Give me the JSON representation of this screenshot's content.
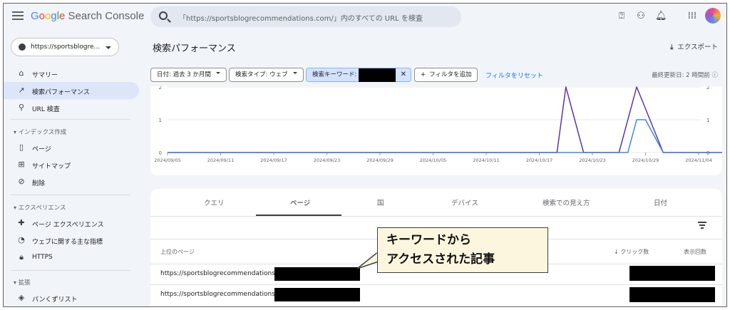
{
  "app": {
    "title_google": "Google",
    "title_rest": " Search Console"
  },
  "search": {
    "placeholder": "「https://sportsblogrecommendations.com/」内のすべての URL を検査"
  },
  "property": {
    "label": "https://sportsblogre..."
  },
  "sidebar": {
    "items": [
      {
        "label": "サマリー",
        "icon": "home-icon"
      },
      {
        "label": "検索パフォーマンス",
        "icon": "trending-icon"
      },
      {
        "label": "URL 検査",
        "icon": "search-icon"
      }
    ],
    "sections": [
      {
        "title": "インデックス作成",
        "items": [
          {
            "label": "ページ",
            "icon": "page-icon"
          },
          {
            "label": "サイトマップ",
            "icon": "sitemap-icon"
          },
          {
            "label": "削除",
            "icon": "remove-icon"
          }
        ]
      },
      {
        "title": "エクスペリエンス",
        "items": [
          {
            "label": "ページ エクスペリエンス",
            "icon": "experience-icon"
          },
          {
            "label": "ウェブに関する主な指標",
            "icon": "speed-icon"
          },
          {
            "label": "HTTPS",
            "icon": "lock-icon"
          }
        ]
      },
      {
        "title": "拡張",
        "items": [
          {
            "label": "パンくずリスト",
            "icon": "breadcrumb-icon"
          }
        ]
      }
    ]
  },
  "header": {
    "title": "検索パフォーマンス",
    "export": "エクスポート"
  },
  "filters": {
    "date": "日付: 過去 3 か月間",
    "type": "検索タイプ: ウェブ",
    "keyword": "検索キーワード:",
    "add": "フィルタを追加",
    "reset": "フィルタをリセット",
    "updated": "最終更新日: 2 時間前"
  },
  "chart_data": {
    "type": "line",
    "x": [
      "2024/09/05",
      "2024/09/11",
      "2024/09/17",
      "2024/09/23",
      "2024/09/29",
      "2024/10/05",
      "2024/10/11",
      "2024/10/17",
      "2024/10/23",
      "2024/10/29",
      "2024/11/04"
    ],
    "left_ticks": [
      "2",
      "1",
      "0"
    ],
    "right_ticks": [
      "2",
      "1",
      "0"
    ],
    "series": [
      {
        "color": "#5e35b1",
        "points": [
          [
            "2024/09/05",
            0
          ],
          [
            "2024/10/19",
            0
          ],
          [
            "2024/10/20",
            2
          ],
          [
            "2024/10/22",
            0
          ],
          [
            "2024/10/26",
            0
          ],
          [
            "2024/10/28",
            2
          ],
          [
            "2024/10/31",
            0
          ],
          [
            "2024/11/08",
            0
          ]
        ]
      },
      {
        "color": "#4285f4",
        "points": [
          [
            "2024/09/05",
            0
          ],
          [
            "2024/10/27",
            0
          ],
          [
            "2024/10/28",
            1
          ],
          [
            "2024/10/29",
            1
          ],
          [
            "2024/10/31",
            0
          ],
          [
            "2024/11/08",
            0
          ]
        ]
      }
    ],
    "ylim": [
      0,
      2
    ]
  },
  "tabs": [
    "クエリ",
    "ページ",
    "国",
    "デバイス",
    "検索での見え方",
    "日付"
  ],
  "table": {
    "col_page": "上位のページ",
    "col_clicks": "クリック数",
    "col_impr": "表示回数",
    "rows": [
      "https://sportsblogrecommendations.com",
      "https://sportsblogrecommendations.com"
    ]
  },
  "callout": {
    "line1": "キーワードから",
    "line2": "アクセスされた記事"
  }
}
